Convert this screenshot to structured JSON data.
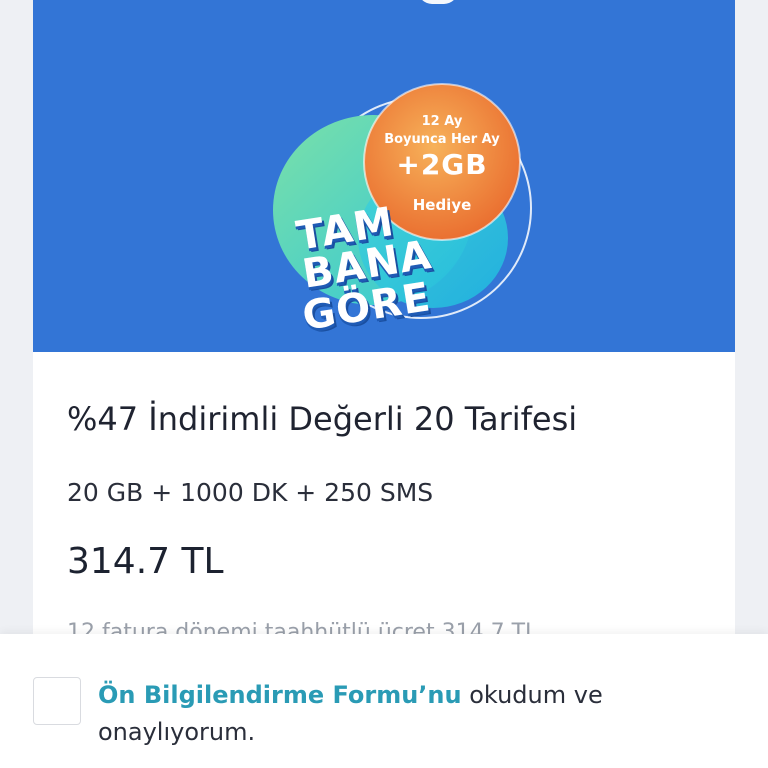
{
  "banner": {
    "background": "#3375d6",
    "promo": {
      "line1": "12 Ay",
      "line2": "Boyunca Her Ay",
      "headline": "+2GB",
      "sub": "Hediye"
    },
    "brand_lines": [
      "TAM",
      "BANA",
      "GÖRE"
    ]
  },
  "tariff": {
    "title": "%47 İndirimli Değerli 20 Tarifesi",
    "features": "20 GB + 1000 DK + 250 SMS",
    "price": "314.7 TL",
    "commitment": "12 fatura dönemi taahhütlü ücret 314.7 TL"
  },
  "consent": {
    "link_text": "Ön Bilgilendirme Formu’nu",
    "rest_text": " okudum ve onaylıyorum.",
    "checked": false,
    "link_color": "#2a9bb5"
  }
}
